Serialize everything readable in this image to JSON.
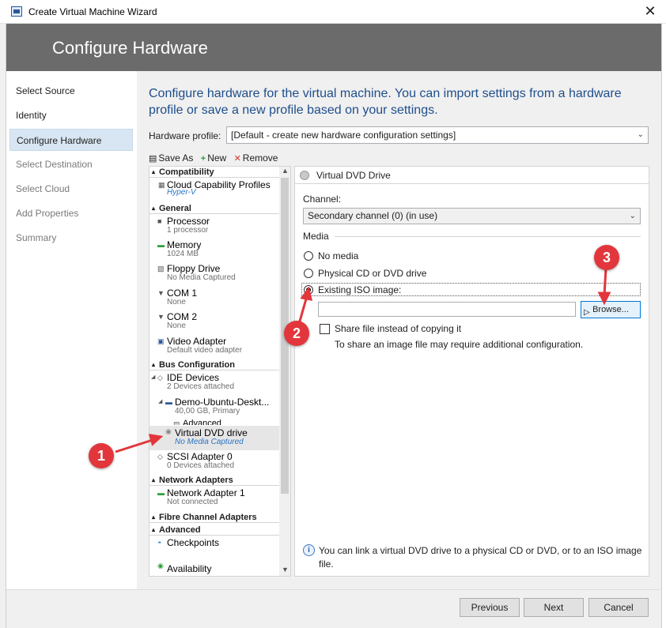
{
  "window": {
    "title": "Create Virtual Machine Wizard",
    "close_glyph": "✕"
  },
  "banner": {
    "heading": "Configure Hardware"
  },
  "nav": {
    "items": [
      {
        "label": "Select Source",
        "state": "normal"
      },
      {
        "label": "Identity",
        "state": "normal"
      },
      {
        "label": "Configure Hardware",
        "state": "active"
      },
      {
        "label": "Select Destination",
        "state": "disabled"
      },
      {
        "label": "Select Cloud",
        "state": "disabled"
      },
      {
        "label": "Add Properties",
        "state": "disabled"
      },
      {
        "label": "Summary",
        "state": "disabled"
      }
    ]
  },
  "intro": "Configure hardware for the virtual machine. You can import settings from a hardware profile or save a new profile based on your settings.",
  "hardware_profile": {
    "label": "Hardware profile:",
    "value": "[Default - create new hardware configuration settings]"
  },
  "toolbar": {
    "save_as": "Save As",
    "new": "New",
    "remove": "Remove"
  },
  "tree": {
    "sections": {
      "compatibility": "Compatibility",
      "general": "General",
      "bus": "Bus Configuration",
      "network": "Network Adapters",
      "fibre": "Fibre Channel Adapters",
      "advanced": "Advanced"
    },
    "items": {
      "cloud": {
        "name": "Cloud Capability Profiles",
        "sub": "Hyper-V"
      },
      "processor": {
        "name": "Processor",
        "sub": "1 processor"
      },
      "memory": {
        "name": "Memory",
        "sub": "1024 MB"
      },
      "floppy": {
        "name": "Floppy Drive",
        "sub": "No Media Captured"
      },
      "com1": {
        "name": "COM 1",
        "sub": "None"
      },
      "com2": {
        "name": "COM 2",
        "sub": "None"
      },
      "video": {
        "name": "Video Adapter",
        "sub": "Default video adapter"
      },
      "ide": {
        "name": "IDE Devices",
        "sub": "2 Devices attached"
      },
      "disk": {
        "name": "Demo-Ubuntu-Deskt...",
        "sub": "40,00 GB, Primary"
      },
      "advanced_partial": {
        "name": "Advanced"
      },
      "dvd": {
        "name": "Virtual DVD drive",
        "sub": "No Media Captured"
      },
      "scsi": {
        "name": "SCSI Adapter 0",
        "sub": "0 Devices attached"
      },
      "nic": {
        "name": "Network Adapter 1",
        "sub": "Not connected"
      },
      "checkpoints": {
        "name": "Checkpoints"
      },
      "availability": {
        "name": "Availability"
      }
    }
  },
  "detail": {
    "title": "Virtual DVD Drive",
    "channel_label": "Channel:",
    "channel_value": "Secondary channel (0) (in use)",
    "media_label": "Media",
    "options": {
      "no_media": "No media",
      "physical": "Physical CD or DVD drive",
      "iso": "Existing ISO image:"
    },
    "selected_option": "iso",
    "iso_path": "",
    "browse": "Browse...",
    "share_label": "Share file instead of copying it",
    "share_checked": false,
    "share_note": "To share an image file may require additional configuration.",
    "info": "You can link a virtual DVD drive to a physical CD or DVD, or to an ISO image file."
  },
  "footer": {
    "previous": "Previous",
    "next": "Next",
    "cancel": "Cancel"
  },
  "annotations": {
    "marker1": "1",
    "marker2": "2",
    "marker3": "3",
    "color": "#e2363c"
  }
}
